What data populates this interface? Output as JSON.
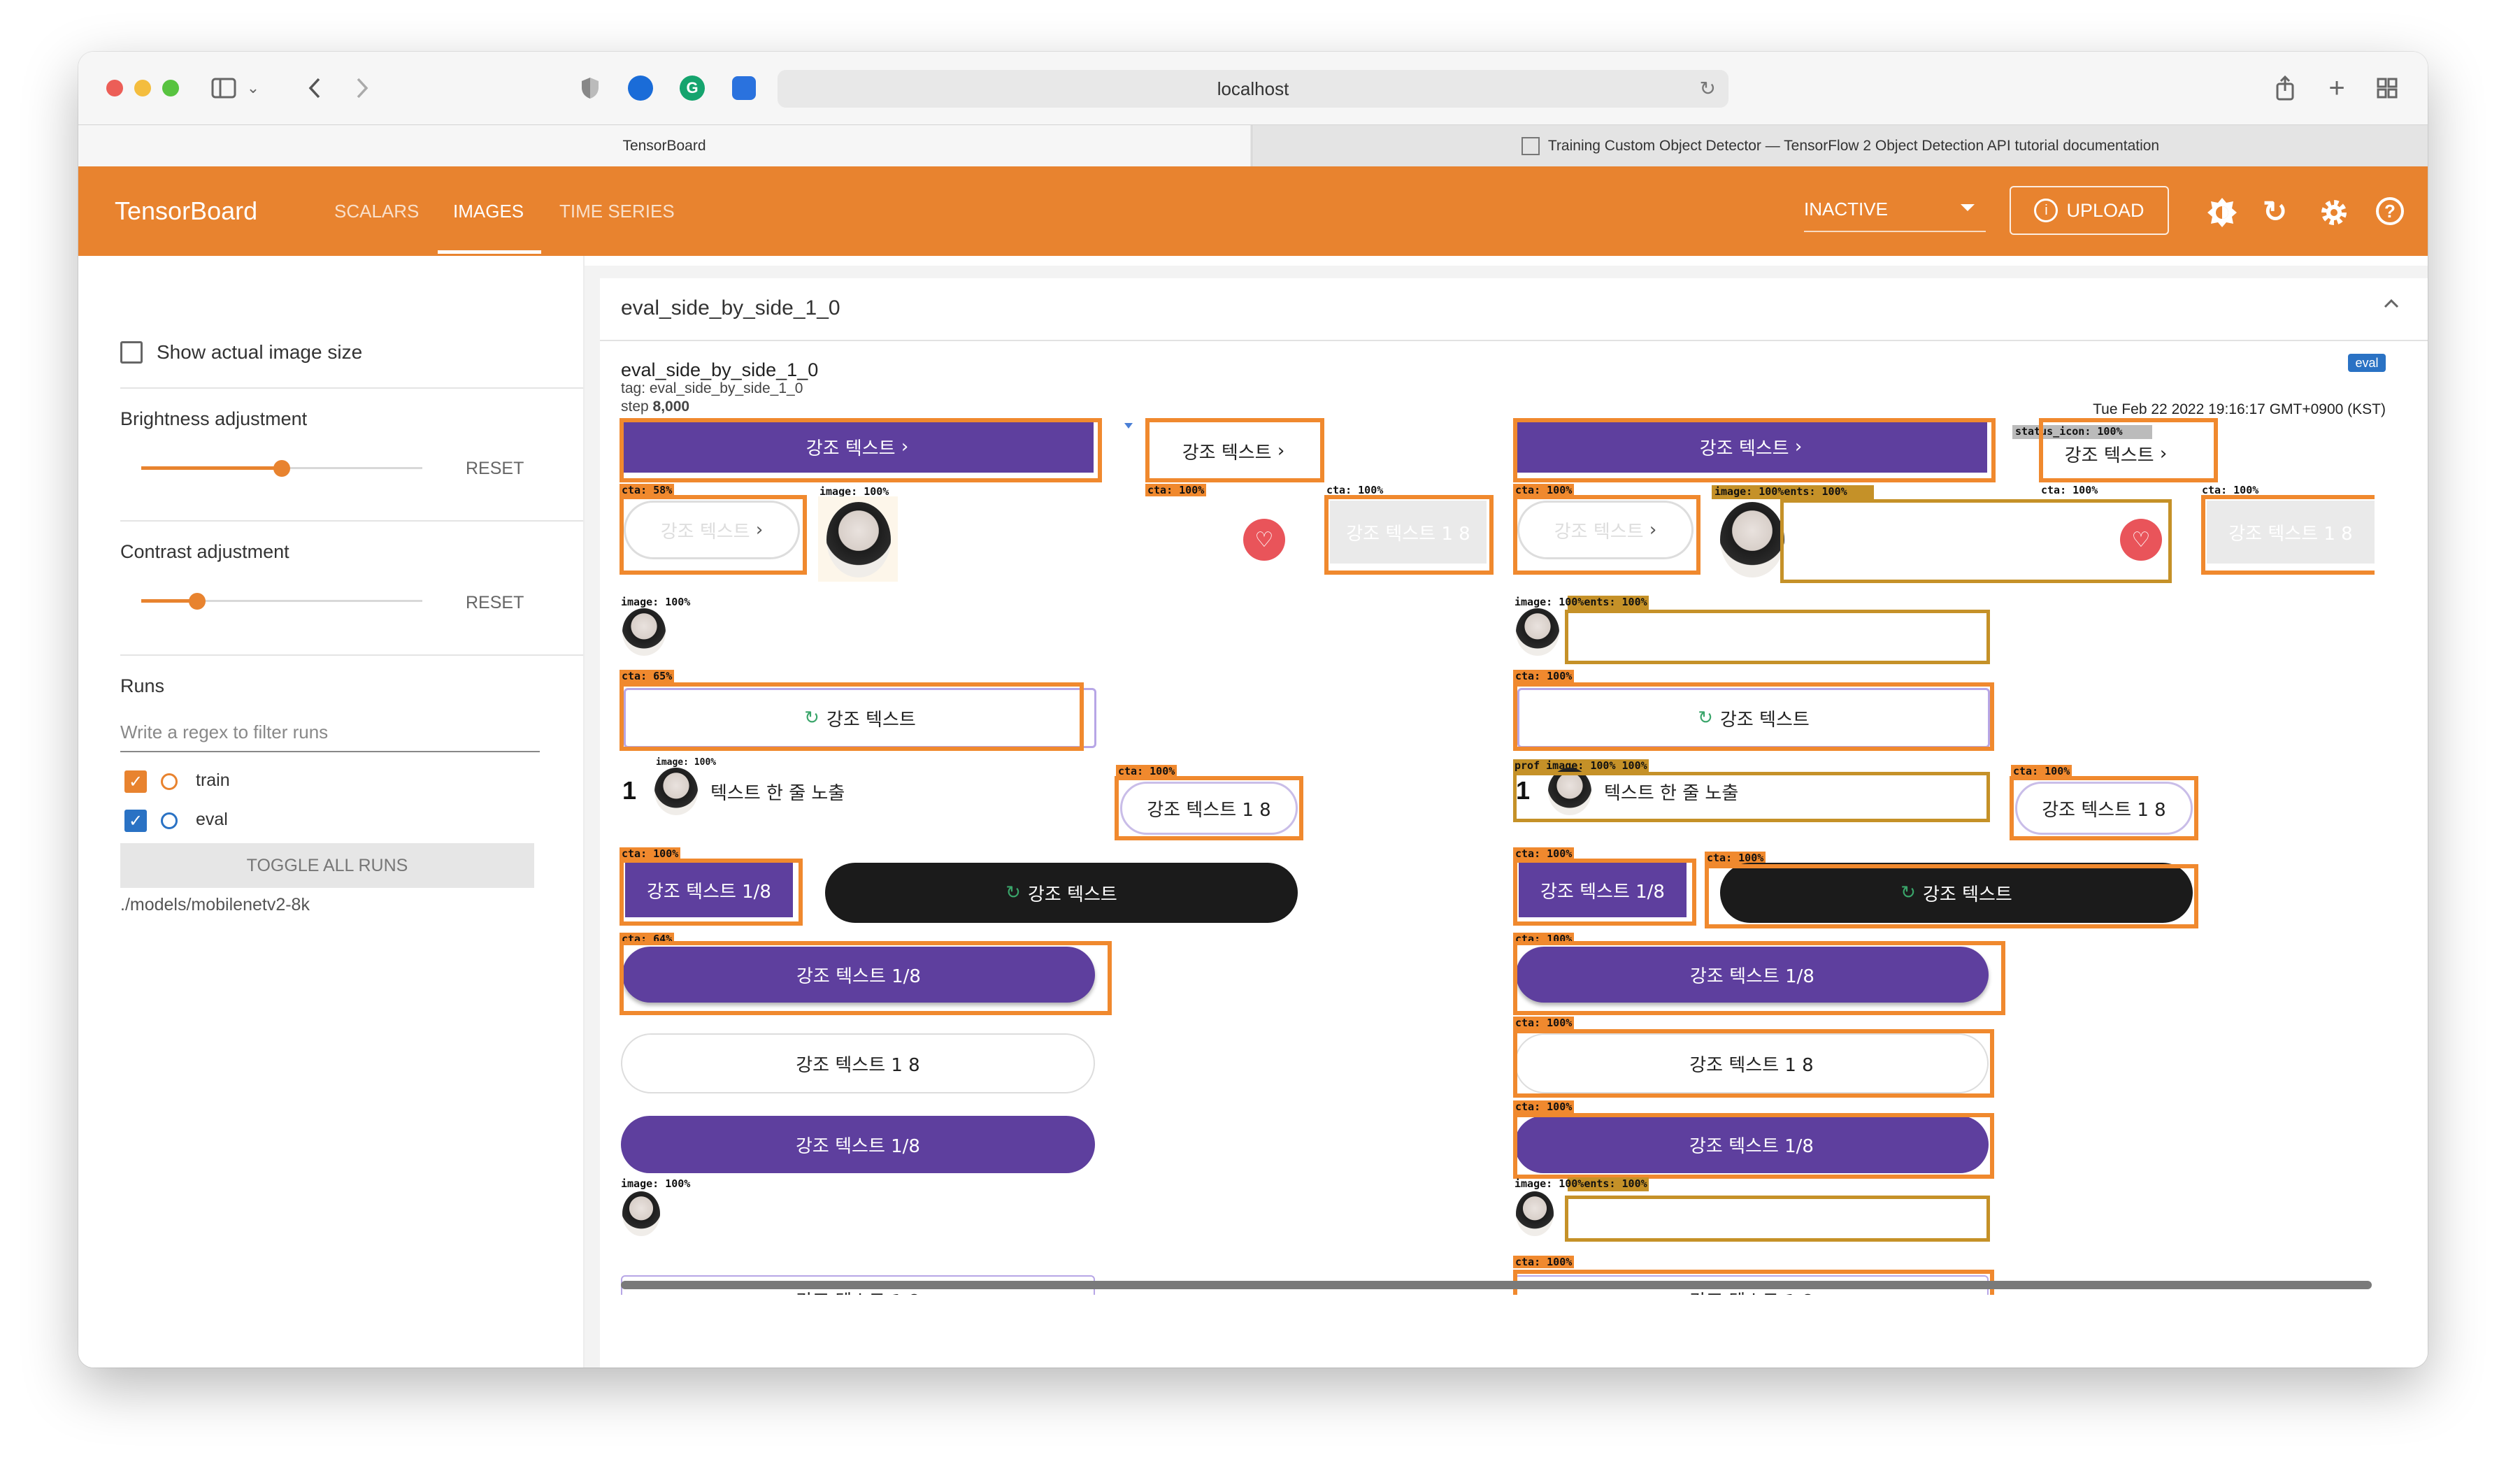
{
  "browser": {
    "url": "localhost",
    "tabs": [
      {
        "label": "TensorBoard"
      },
      {
        "label": "Training Custom Object Detector — TensorFlow 2 Object Detection API tutorial documentation"
      }
    ]
  },
  "header": {
    "brand": "TensorBoard",
    "nav": [
      {
        "label": "SCALARS"
      },
      {
        "label": "IMAGES"
      },
      {
        "label": "TIME SERIES"
      }
    ],
    "run_select": "INACTIVE",
    "upload": "UPLOAD",
    "accent_color": "#e8832f"
  },
  "sidebar": {
    "show_actual_size": "Show actual image size",
    "brightness": {
      "label": "Brightness adjustment",
      "reset": "RESET",
      "value": 0.5
    },
    "contrast": {
      "label": "Contrast adjustment",
      "reset": "RESET",
      "value": 0.2
    },
    "runs": {
      "title": "Runs",
      "filter_placeholder": "Write a regex to filter runs",
      "items": [
        {
          "label": "train",
          "checked": true
        },
        {
          "label": "eval",
          "checked": true
        }
      ],
      "toggle": "TOGGLE ALL RUNS",
      "path": "./models/mobilenetv2-8k"
    }
  },
  "main": {
    "card_title": "eval_side_by_side_1_0",
    "image_title": "eval_side_by_side_1_0",
    "tag": "tag: eval_side_by_side_1_0",
    "step_label": "step",
    "step_value": "8,000",
    "timestamp": "Tue Feb 22 2022 19:16:17 GMT+0900 (KST)",
    "run_badge": "eval"
  },
  "image": {
    "btn_text": "강조 텍스트",
    "btn_text_frac": "강조 텍스트  1/8",
    "btn_text_frac2": "강조 텍스트  1  8",
    "list_num": "1",
    "list_text": "텍스트 한 줄 노출",
    "labels": {
      "cta58": "cta: 58%",
      "cta65": "cta: 65%",
      "cta64": "cta: 64%",
      "cta100": "cta: 100%",
      "image100": "image: 100%",
      "image100ents": "image: 100%ents: 100%",
      "status_icon": "status_icon: 100%",
      "prof": "prof image: 100% 100%"
    }
  }
}
